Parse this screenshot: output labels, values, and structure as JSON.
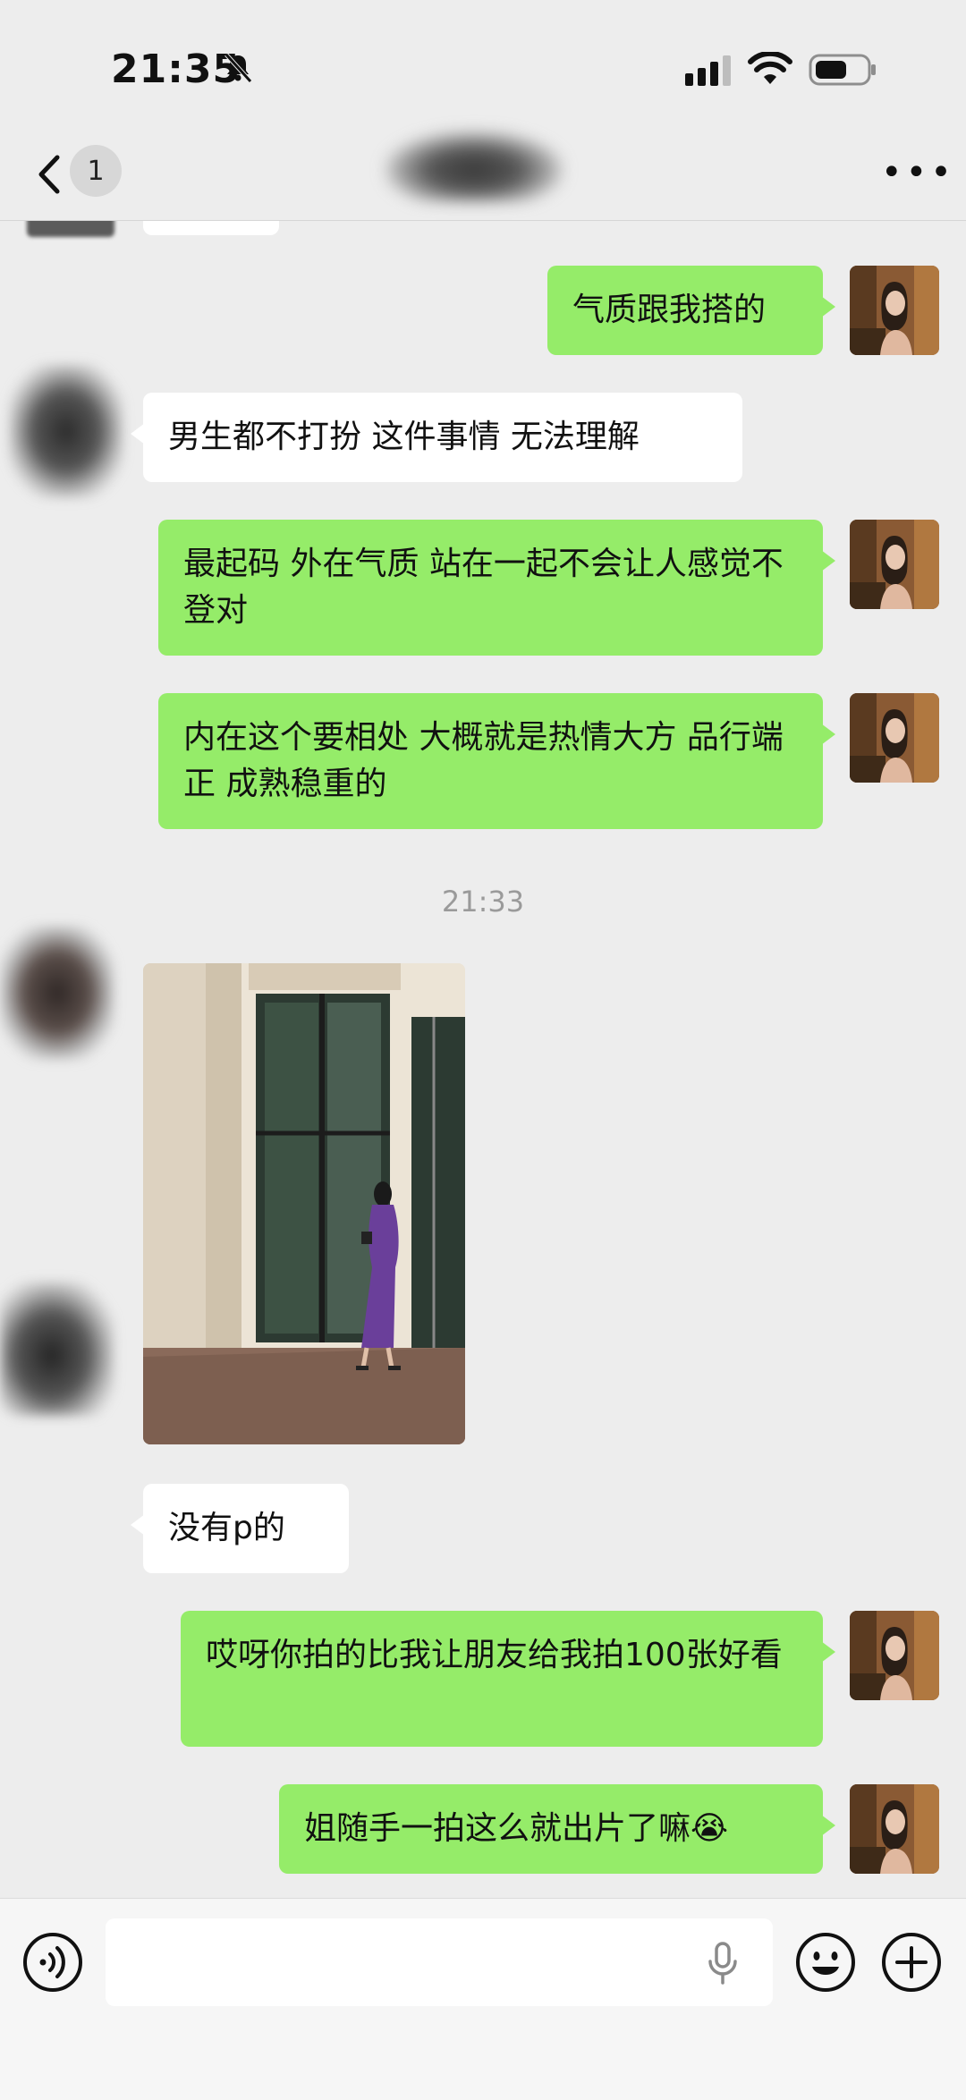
{
  "status_bar": {
    "time": "21:35"
  },
  "nav": {
    "badge_count": "1",
    "more": "•••"
  },
  "messages": [
    {
      "from": "me",
      "text": "气质跟我搭的"
    },
    {
      "from": "other",
      "text": "男生都不打扮 这件事情 无法理解"
    },
    {
      "from": "me",
      "text": "最起码 外在气质 站在一起不会让人感觉不登对"
    },
    {
      "from": "me",
      "text": "内在这个要相处 大概就是热情大方 品行端正 成熟稳重的"
    },
    {
      "type": "timestamp",
      "text": "21:33"
    },
    {
      "from": "other",
      "type": "image"
    },
    {
      "from": "other",
      "text": "没有p的"
    },
    {
      "from": "me",
      "text": "哎呀你拍的比我让朋友给我拍100张好看"
    },
    {
      "from": "me",
      "text": "姐随手一拍这么就出片了嘛😭"
    }
  ],
  "colors": {
    "my_bubble": "#95ec69",
    "their_bubble": "#ffffff",
    "background": "#ededed"
  },
  "icons": [
    "bell-slash-icon",
    "signal-icon",
    "wifi-icon",
    "battery-icon",
    "back-chevron-icon",
    "more-icon",
    "voice-icon",
    "mic-icon",
    "emoji-icon",
    "plus-icon"
  ]
}
